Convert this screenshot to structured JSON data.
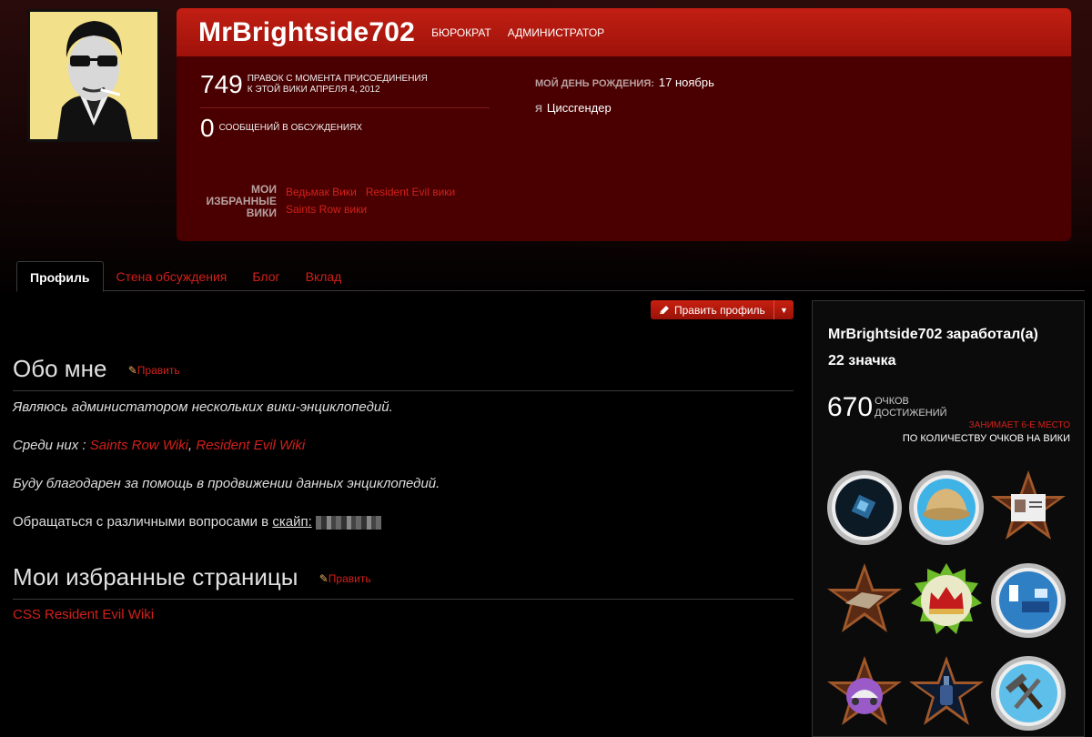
{
  "user": {
    "name": "MrBrightside702",
    "groups": [
      "БЮРОКРАТ",
      "АДМИНИСТРАТОР"
    ],
    "edits_count": "749",
    "edits_label_line1": "ПРАВОК С МОМЕНТА ПРИСОЕДИНЕНИЯ",
    "edits_label_line2": "К ЭТОЙ ВИКИ АПРЕЛЯ 4, 2012",
    "posts_count": "0",
    "posts_label": "СООБЩЕНИЙ В ОБСУЖДЕНИЯХ",
    "birthday_label": "МОЙ ДЕНЬ РОЖДЕНИЯ:",
    "birthday_value": "17 ноябрь",
    "gender_label": "Я",
    "gender_value": "Циссгендер",
    "fav_label_lines": [
      "МОИ",
      "ИЗБРАННЫЕ",
      "ВИКИ"
    ],
    "fav_wikis": [
      "Ведьмак Вики",
      "Resident Evil вики",
      "Saints Row вики"
    ]
  },
  "tabs": [
    "Профиль",
    "Стена обсуждения",
    "Блог",
    "Вклад"
  ],
  "edit_profile_button": "Править профиль",
  "about": {
    "heading": "Обо мне",
    "edit_link": "Править",
    "line1": "Являюсь администатором нескольких вики-энциклопедий.",
    "line2_prefix": "Среди них : ",
    "line2_link1": "Saints Row Wiki",
    "line2_sep": ", ",
    "line2_link2": "Resident Evil Wiki",
    "line3": "Буду благодарен за помощь в продвижении данных энциклопедий.",
    "line4_prefix": "Обращаться с различными вопросами в ",
    "line4_link": "скайп:"
  },
  "favorites": {
    "heading": "Мои избранные страницы",
    "edit_link": "Править",
    "item": "CSS Resident Evil Wiki"
  },
  "achievements": {
    "title_line1": "MrBrightside702 заработал(а)",
    "title_line2": "22 значка",
    "points": "670",
    "points_label_line1": "ОЧКОВ",
    "points_label_line2": "ДОСТИЖЕНИЙ",
    "rank_line1": "ЗАНИМАЕТ 6-Е МЕСТО",
    "rank_line2": "ПО КОЛИЧЕСТВУ ОЧКОВ НА ВИКИ",
    "badges": [
      "cube-badge",
      "pith-helmet-badge",
      "police-id-badge",
      "map-badge",
      "crown-badge",
      "room-badge",
      "wagon-badge",
      "bottle-badge",
      "hammer-badge"
    ]
  },
  "colors": {
    "accent": "#d0201a",
    "header_bg": "#4a0000",
    "header_bar": "#b81a10"
  }
}
